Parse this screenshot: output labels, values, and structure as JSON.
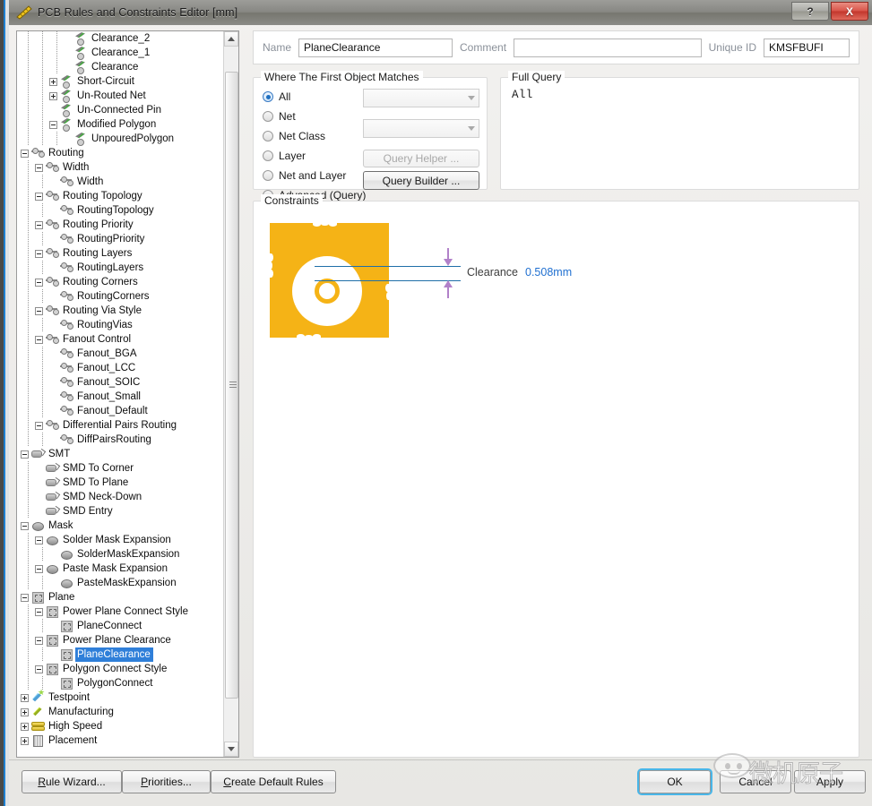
{
  "window": {
    "title": "PCB Rules and Constraints Editor [mm]",
    "icon": "ruler-icon",
    "help_label": "?",
    "close_label": "X"
  },
  "tree": {
    "items": [
      {
        "label": "Clearance_2",
        "indent": 4,
        "icon": "clearance-icon",
        "node": "leaf"
      },
      {
        "label": "Clearance_1",
        "indent": 4,
        "icon": "clearance-icon",
        "node": "leaf"
      },
      {
        "label": "Clearance",
        "indent": 4,
        "icon": "clearance-icon",
        "node": "leaf"
      },
      {
        "label": "Short-Circuit",
        "indent": 3,
        "icon": "clearance-icon",
        "node": "plus"
      },
      {
        "label": "Un-Routed Net",
        "indent": 3,
        "icon": "clearance-icon",
        "node": "plus"
      },
      {
        "label": "Un-Connected Pin",
        "indent": 3,
        "icon": "clearance-icon",
        "node": "leaf"
      },
      {
        "label": "Modified Polygon",
        "indent": 3,
        "icon": "clearance-icon",
        "node": "minus"
      },
      {
        "label": "UnpouredPolygon",
        "indent": 4,
        "icon": "clearance-icon",
        "node": "leaf"
      },
      {
        "label": "Routing",
        "indent": 1,
        "icon": "routing-icon",
        "node": "minus"
      },
      {
        "label": "Width",
        "indent": 2,
        "icon": "routing-icon",
        "node": "minus"
      },
      {
        "label": "Width",
        "indent": 3,
        "icon": "routing-icon",
        "node": "leaf"
      },
      {
        "label": "Routing Topology",
        "indent": 2,
        "icon": "routing-icon",
        "node": "minus"
      },
      {
        "label": "RoutingTopology",
        "indent": 3,
        "icon": "routing-icon",
        "node": "leaf"
      },
      {
        "label": "Routing Priority",
        "indent": 2,
        "icon": "routing-icon",
        "node": "minus"
      },
      {
        "label": "RoutingPriority",
        "indent": 3,
        "icon": "routing-icon",
        "node": "leaf"
      },
      {
        "label": "Routing Layers",
        "indent": 2,
        "icon": "routing-icon",
        "node": "minus"
      },
      {
        "label": "RoutingLayers",
        "indent": 3,
        "icon": "routing-icon",
        "node": "leaf"
      },
      {
        "label": "Routing Corners",
        "indent": 2,
        "icon": "routing-icon",
        "node": "minus"
      },
      {
        "label": "RoutingCorners",
        "indent": 3,
        "icon": "routing-icon",
        "node": "leaf"
      },
      {
        "label": "Routing Via Style",
        "indent": 2,
        "icon": "routing-icon",
        "node": "minus"
      },
      {
        "label": "RoutingVias",
        "indent": 3,
        "icon": "routing-icon",
        "node": "leaf"
      },
      {
        "label": "Fanout Control",
        "indent": 2,
        "icon": "routing-icon",
        "node": "minus"
      },
      {
        "label": "Fanout_BGA",
        "indent": 3,
        "icon": "routing-icon",
        "node": "leaf"
      },
      {
        "label": "Fanout_LCC",
        "indent": 3,
        "icon": "routing-icon",
        "node": "leaf"
      },
      {
        "label": "Fanout_SOIC",
        "indent": 3,
        "icon": "routing-icon",
        "node": "leaf"
      },
      {
        "label": "Fanout_Small",
        "indent": 3,
        "icon": "routing-icon",
        "node": "leaf"
      },
      {
        "label": "Fanout_Default",
        "indent": 3,
        "icon": "routing-icon",
        "node": "leaf"
      },
      {
        "label": "Differential Pairs Routing",
        "indent": 2,
        "icon": "routing-icon",
        "node": "minus"
      },
      {
        "label": "DiffPairsRouting",
        "indent": 3,
        "icon": "routing-icon",
        "node": "leaf"
      },
      {
        "label": "SMT",
        "indent": 1,
        "icon": "smt-icon",
        "node": "minus"
      },
      {
        "label": "SMD To Corner",
        "indent": 2,
        "icon": "smt-icon",
        "node": "leaf"
      },
      {
        "label": "SMD To Plane",
        "indent": 2,
        "icon": "smt-icon",
        "node": "leaf"
      },
      {
        "label": "SMD Neck-Down",
        "indent": 2,
        "icon": "smt-icon",
        "node": "leaf"
      },
      {
        "label": "SMD Entry",
        "indent": 2,
        "icon": "smt-icon",
        "node": "leaf"
      },
      {
        "label": "Mask",
        "indent": 1,
        "icon": "mask-icon",
        "node": "minus"
      },
      {
        "label": "Solder Mask Expansion",
        "indent": 2,
        "icon": "mask-icon",
        "node": "minus"
      },
      {
        "label": "SolderMaskExpansion",
        "indent": 3,
        "icon": "mask-icon",
        "node": "leaf"
      },
      {
        "label": "Paste Mask Expansion",
        "indent": 2,
        "icon": "mask-icon",
        "node": "minus"
      },
      {
        "label": "PasteMaskExpansion",
        "indent": 3,
        "icon": "mask-icon",
        "node": "leaf"
      },
      {
        "label": "Plane",
        "indent": 1,
        "icon": "plane-icon",
        "node": "minus"
      },
      {
        "label": "Power Plane Connect Style",
        "indent": 2,
        "icon": "plane-icon",
        "node": "minus"
      },
      {
        "label": "PlaneConnect",
        "indent": 3,
        "icon": "plane-icon",
        "node": "leaf"
      },
      {
        "label": "Power Plane Clearance",
        "indent": 2,
        "icon": "plane-icon",
        "node": "minus"
      },
      {
        "label": "PlaneClearance",
        "indent": 3,
        "icon": "plane-icon",
        "node": "leaf",
        "selected": true
      },
      {
        "label": "Polygon Connect Style",
        "indent": 2,
        "icon": "plane-icon",
        "node": "minus"
      },
      {
        "label": "PolygonConnect",
        "indent": 3,
        "icon": "plane-icon",
        "node": "leaf"
      },
      {
        "label": "Testpoint",
        "indent": 1,
        "icon": "testpoint-icon",
        "node": "plus"
      },
      {
        "label": "Manufacturing",
        "indent": 1,
        "icon": "manufacturing-icon",
        "node": "plus"
      },
      {
        "label": "High Speed",
        "indent": 1,
        "icon": "highspeed-icon",
        "node": "plus"
      },
      {
        "label": "Placement",
        "indent": 1,
        "icon": "placement-icon",
        "node": "plus"
      }
    ],
    "selected": "PlaneClearance"
  },
  "fields": {
    "name_label": "Name",
    "name_value": "PlaneClearance",
    "comment_label": "Comment",
    "comment_value": "",
    "comment_placeholder": "",
    "unique_id_label": "Unique ID",
    "unique_id_value": "KMSFBUFI"
  },
  "match_group": {
    "title": "Where The First Object Matches",
    "options": [
      {
        "label": "All",
        "selected": true
      },
      {
        "label": "Net",
        "selected": false
      },
      {
        "label": "Net Class",
        "selected": false
      },
      {
        "label": "Layer",
        "selected": false
      },
      {
        "label": "Net and Layer",
        "selected": false
      },
      {
        "label": "Advanced (Query)",
        "selected": false
      }
    ],
    "net_combo_value": "",
    "netclass_combo_value": "",
    "query_helper_label": "Query Helper ...",
    "query_builder_label": "Query Builder ..."
  },
  "full_query": {
    "title": "Full Query",
    "text": "All"
  },
  "constraints": {
    "title": "Constraints",
    "clearance_label": "Clearance",
    "clearance_value": "0.508mm",
    "plane_color": "#f5b316",
    "dim_arrow_color": "#b181c9",
    "leader_color": "#1f6fa8",
    "value_color": "#1f6fd0"
  },
  "footer": {
    "rule_wizard": {
      "accel": "R",
      "rest": "ule Wizard..."
    },
    "priorities": {
      "accel": "P",
      "rest": "riorities..."
    },
    "defaults": {
      "accel": "C",
      "rest": "reate Default Rules"
    },
    "ok": "OK",
    "cancel": "Cancel",
    "apply": "Apply"
  },
  "watermark": {
    "text": "微机原子",
    "icon": "chat-bubble-icon"
  }
}
